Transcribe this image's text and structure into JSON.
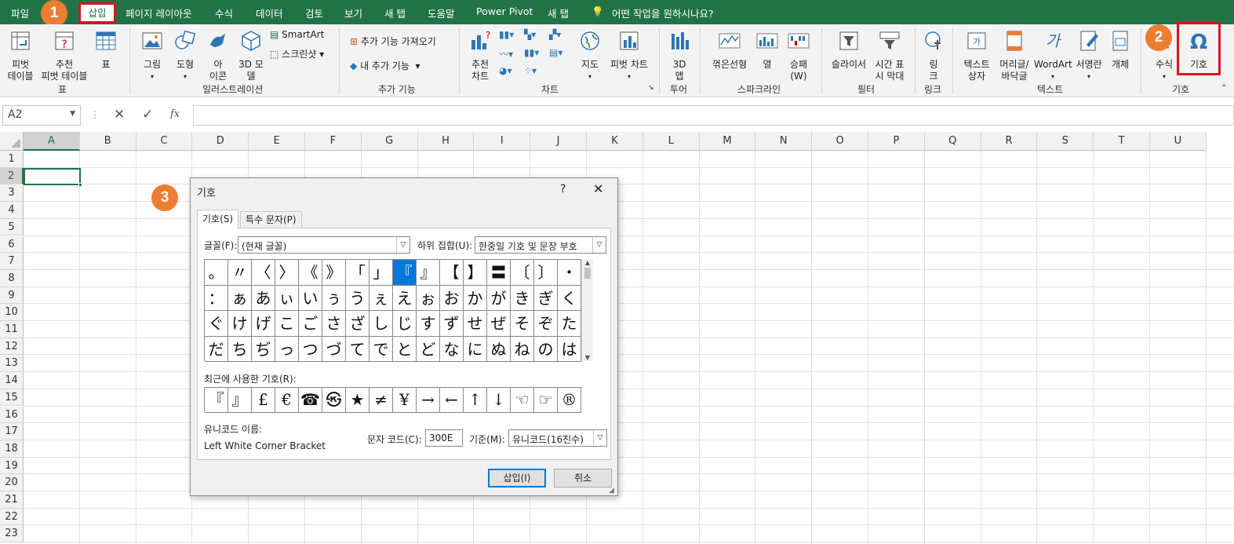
{
  "menu": {
    "items": [
      "파일",
      "삽입",
      "페이지 레이아웃",
      "수식",
      "데이터",
      "검토",
      "보기",
      "새 탭",
      "도움말",
      "Power Pivot",
      "새 탭"
    ],
    "tell_me": "어떤 작업을 원하시나요?"
  },
  "badges": [
    "1",
    "2",
    "3"
  ],
  "ribbon": {
    "tables": {
      "pivot": "피벗\n테이블",
      "recommended": "추천\n피벗 테이블",
      "table": "표",
      "group": "표"
    },
    "illustrations": {
      "pictures": "그림",
      "shapes": "도형",
      "icons": "아\n이콘",
      "models": "3D 모\n델",
      "smartart": "SmartArt",
      "screenshot": "스크린샷",
      "group": "일러스트레이션"
    },
    "addins": {
      "get": "추가 기능 가져오기",
      "my": "내 추가 기능",
      "group": "추가 기능"
    },
    "charts": {
      "recommended": "추천\n차트",
      "maps": "지도",
      "pivotchart": "피벗 차트",
      "group": "차트"
    },
    "tours": {
      "map3d": "3D\n맵",
      "group": "투어"
    },
    "sparklines": {
      "line": "꺾은선형",
      "column": "열",
      "winloss": "승패\n(W)",
      "group": "스파크라인"
    },
    "filters": {
      "slicer": "슬라이서",
      "timeline": "시간 표\n시 막대",
      "group": "필터"
    },
    "links": {
      "link": "링\n크",
      "group": "링크"
    },
    "text": {
      "textbox": "텍스트\n상자",
      "headerfooter": "머리글/\n바닥글",
      "wordart": "WordArt",
      "signature": "서명란",
      "object": "개체",
      "group": "텍스트"
    },
    "symbols": {
      "equation": "수식",
      "symbol": "기호",
      "group": "기호"
    }
  },
  "formula_bar": {
    "name_box": "A2",
    "fx": "fx"
  },
  "columns": [
    "A",
    "B",
    "C",
    "D",
    "E",
    "F",
    "G",
    "H",
    "I",
    "J",
    "K",
    "L",
    "M",
    "N",
    "O",
    "P",
    "Q",
    "R",
    "S",
    "T",
    "U"
  ],
  "rows": [
    "1",
    "2",
    "3",
    "4",
    "5",
    "6",
    "7",
    "8",
    "9",
    "10",
    "11",
    "12",
    "13",
    "14",
    "15",
    "16",
    "17",
    "18",
    "19",
    "20",
    "21",
    "22",
    "23"
  ],
  "dialog": {
    "title": "기호",
    "help": "?",
    "close": "✕",
    "tabs": [
      "기호(S)",
      "특수 문자(P)"
    ],
    "font_label": "글꼴(F):",
    "font_value": "(현재 글꼴)",
    "subset_label": "하위 집합(U):",
    "subset_value": "한중일 기호 및 문장 부호",
    "symbols": [
      [
        "。",
        "〃",
        "〈",
        "〉",
        "《",
        "》",
        "「",
        "」",
        "『",
        "』",
        "【",
        "】",
        "〓",
        "〔",
        "〕",
        "・"
      ],
      [
        "：",
        "ぁ",
        "あ",
        "ぃ",
        "い",
        "ぅ",
        "う",
        "ぇ",
        "え",
        "ぉ",
        "お",
        "か",
        "が",
        "き",
        "ぎ",
        "く"
      ],
      [
        "ぐ",
        "け",
        "げ",
        "こ",
        "ご",
        "さ",
        "ざ",
        "し",
        "じ",
        "す",
        "ず",
        "せ",
        "ぜ",
        "そ",
        "ぞ",
        "た"
      ],
      [
        "だ",
        "ち",
        "ぢ",
        "っ",
        "つ",
        "づ",
        "て",
        "で",
        "と",
        "ど",
        "な",
        "に",
        "ぬ",
        "ね",
        "の",
        "は"
      ]
    ],
    "selected_index": 8,
    "recent_label": "최근에 사용한 기호(R):",
    "recent": [
      "『",
      "』",
      "£",
      "€",
      "☎",
      "㉿",
      "★",
      "≠",
      "¥",
      "→",
      "←",
      "↑",
      "↓",
      "☜",
      "☞",
      "®"
    ],
    "unicode_name_label": "유니코드 이름:",
    "unicode_name": "Left White Corner Bracket",
    "char_code_label": "문자 코드(C):",
    "char_code": "300E",
    "from_label": "기준(M):",
    "from_value": "유니코드(16진수)",
    "insert": "삽입(I)",
    "cancel": "취소"
  },
  "colors": {
    "excel_green": "#217346",
    "badge": "#ed7d31",
    "highlight": "#e0101a",
    "selection": "#0078d7"
  }
}
